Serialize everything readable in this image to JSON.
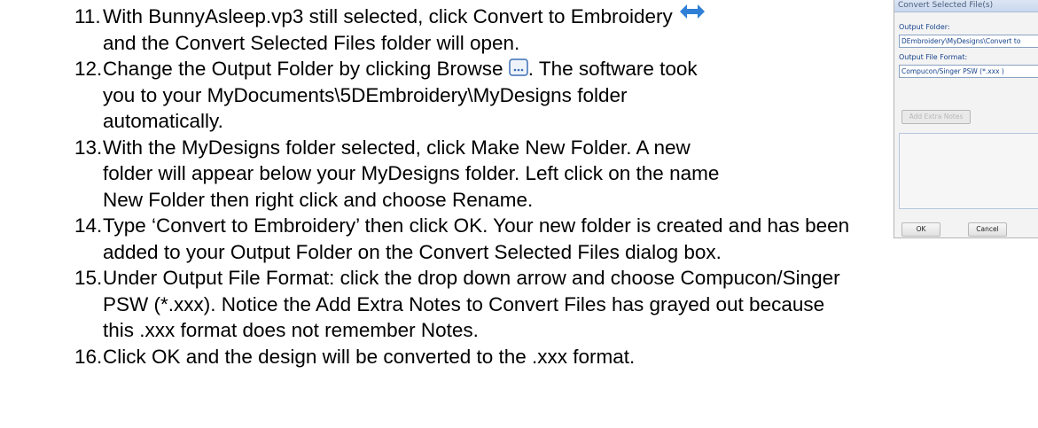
{
  "instructions": {
    "steps": [
      {
        "number": "11.",
        "lines": [
          "With BunnyAsleep.vp3 still selected, click Convert to Embroidery",
          "and the Convert Selected Files folder will open."
        ]
      },
      {
        "number": "12.",
        "lines": [
          "Change the Output Folder by clicking Browse",
          ". The software took",
          "you to your MyDocuments\\5DEmbroidery\\MyDesigns folder",
          "automatically."
        ]
      },
      {
        "number": "13.",
        "lines": [
          "With the MyDesigns folder selected, click Make New Folder. A new",
          "folder will appear below your MyDesigns folder. Left click on the name",
          "New Folder then right click and choose Rename."
        ]
      },
      {
        "number": "14.",
        "lines": [
          "Type ‘Convert to Embroidery’ then click OK. Your new folder is created and has been",
          "added to your Output Folder on the Convert Selected Files dialog box."
        ]
      },
      {
        "number": "15.",
        "lines": [
          "Under Output File Format: click the drop down arrow and choose Compucon/Singer",
          "PSW (*.xxx). Notice the Add Extra Notes to Convert Files has grayed out because",
          "this .xxx format does not remember Notes."
        ]
      },
      {
        "number": "16.",
        "lines": [
          "Click OK and the design will be converted to the .xxx format."
        ]
      }
    ],
    "icons": {
      "convert": "double-arrow-icon",
      "browse": "ellipsis-browse-icon",
      "convert_color": "#2f7fd6"
    }
  },
  "dialog": {
    "title": "Convert Selected File(s)",
    "output_folder_label": "Output Folder:",
    "output_folder_value": "DEmbroidery\\MyDesigns\\Convert to",
    "output_format_label": "Output File Format:",
    "output_format_value": "Compucon/Singer PSW (*.xxx )",
    "add_notes_button": "Add Extra Notes",
    "ok_button": "OK",
    "cancel_button": "Cancel"
  }
}
